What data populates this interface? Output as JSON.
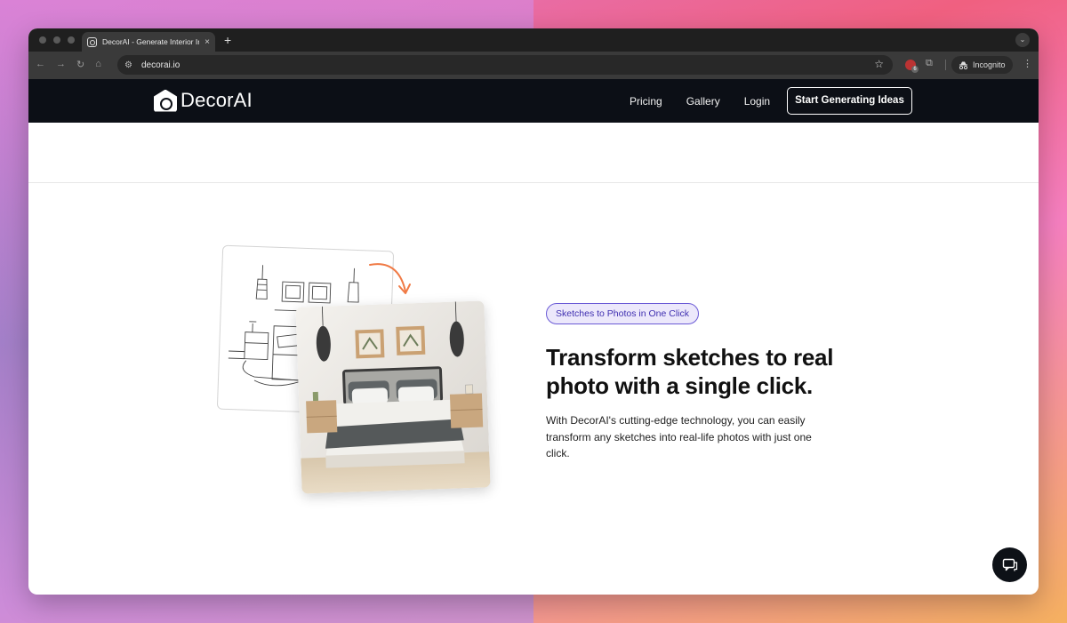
{
  "browser": {
    "tab_title": "DecorAI - Generate Interior In",
    "tab_close": "×",
    "new_tab": "+",
    "url": "decorai.io",
    "extension_badge_count": "6",
    "incognito_label": "Incognito"
  },
  "site": {
    "logo_text": "DecorAI",
    "nav": {
      "pricing": "Pricing",
      "gallery": "Gallery",
      "login": "Login"
    },
    "cta_label": "Start Generating Ideas"
  },
  "hero": {
    "badge": "Sketches to Photos in One Click",
    "headline": "Transform sketches to real photo with a single click.",
    "description": "With DecorAI's cutting-edge technology, you can easily transform any sketches into real-life photos with just one click."
  },
  "colors": {
    "header_bg": "#0c0f16",
    "badge_border": "#6b5bd6",
    "badge_bg": "#ece8fb",
    "arrow": "#f07a45"
  },
  "icons": {
    "back": "arrow-left-icon",
    "forward": "arrow-right-icon",
    "reload": "reload-icon",
    "home": "home-icon",
    "bookmark": "star-icon",
    "chat": "chat-icon"
  }
}
